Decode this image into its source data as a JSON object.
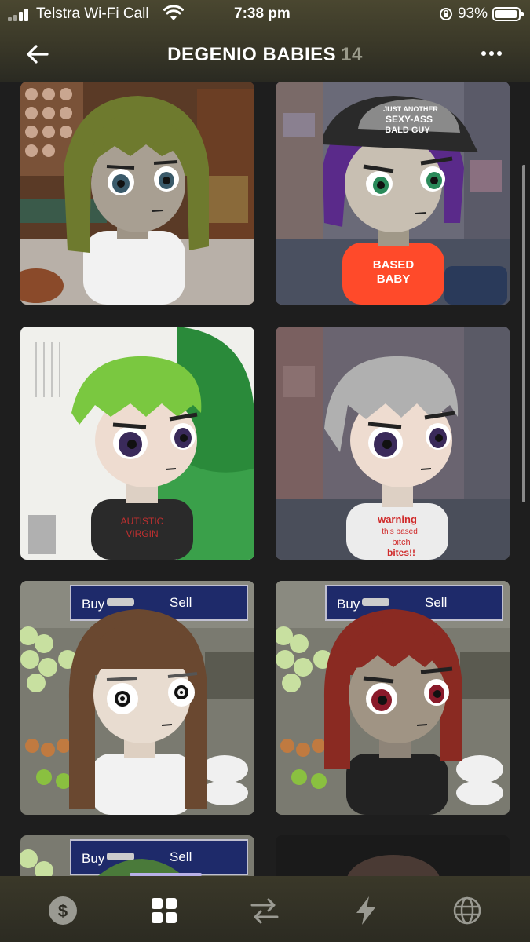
{
  "status_bar": {
    "carrier": "Telstra Wi-Fi Call",
    "time": "7:38 pm",
    "battery": "93%"
  },
  "header": {
    "title": "DEGENIO BABIES",
    "count": "14"
  },
  "nfts": [
    {
      "name": "green-hair-white-shirt"
    },
    {
      "name": "purple-hair-based-baby",
      "cap_text": "JUST ANOTHER SEXY-ASS BALD GUY",
      "shirt_text": "BASED BABY"
    },
    {
      "name": "green-hair-autistic-virgin",
      "shirt_text": "AUTISTIC VIRGIN"
    },
    {
      "name": "grey-hair-warning",
      "shirt_text": "warning this based bitch bites!!"
    },
    {
      "name": "brown-hair-market",
      "sign_left": "Buy",
      "sign_right": "Sell"
    },
    {
      "name": "red-hair-market",
      "sign_left": "Buy",
      "sign_right": "Sell"
    },
    {
      "name": "partial-market",
      "sign_left": "Buy",
      "sign_right": "Sell"
    },
    {
      "name": "partial-dark"
    }
  ],
  "tabs": [
    {
      "name": "wallet",
      "icon": "dollar-icon"
    },
    {
      "name": "collectibles",
      "icon": "grid-icon",
      "active": true
    },
    {
      "name": "swap",
      "icon": "swap-icon"
    },
    {
      "name": "activity",
      "icon": "lightning-icon"
    },
    {
      "name": "browser",
      "icon": "globe-icon"
    }
  ],
  "colors": {
    "accent": "#b8b0e8",
    "background": "#1e1e1e"
  }
}
